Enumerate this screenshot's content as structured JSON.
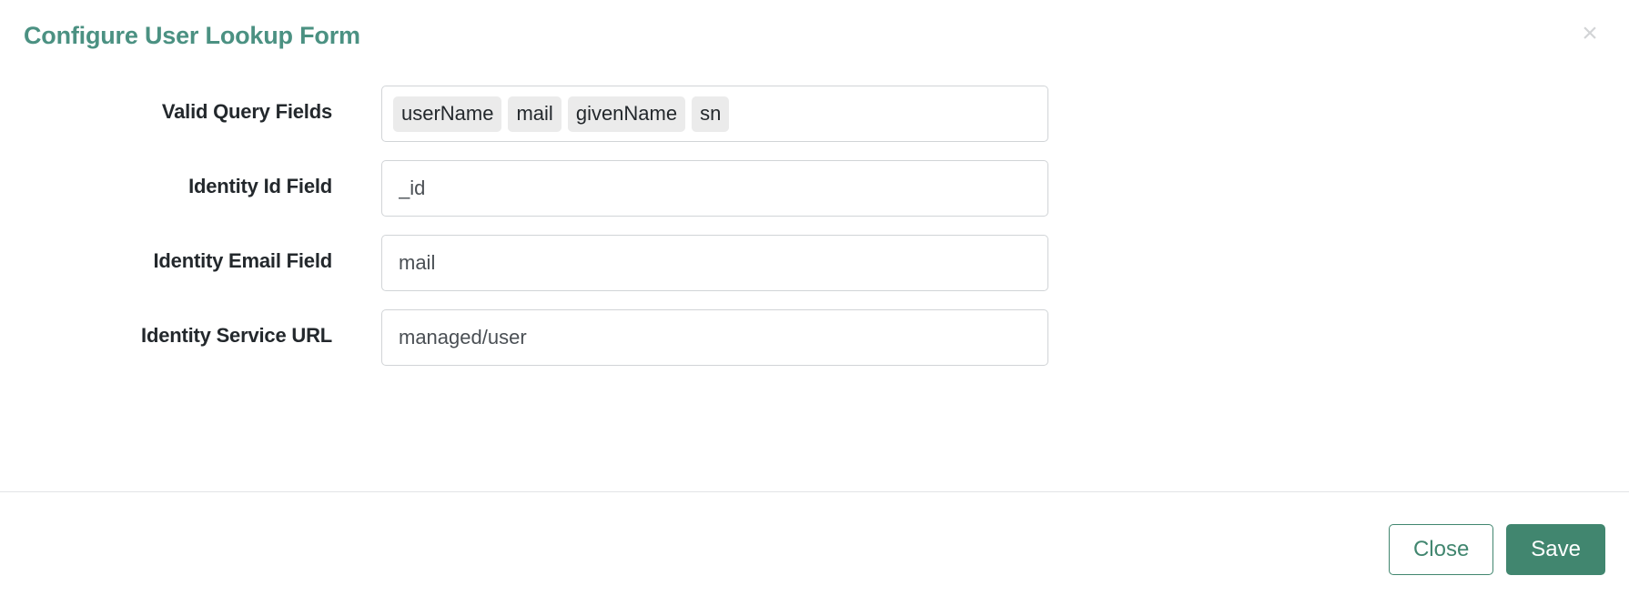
{
  "dialog": {
    "title": "Configure User Lookup Form",
    "close_icon_label": "×"
  },
  "form": {
    "fields": [
      {
        "label": "Valid Query Fields",
        "type": "tags",
        "tags": [
          "userName",
          "mail",
          "givenName",
          "sn"
        ]
      },
      {
        "label": "Identity Id Field",
        "type": "text",
        "value": "_id"
      },
      {
        "label": "Identity Email Field",
        "type": "text",
        "value": "mail"
      },
      {
        "label": "Identity Service URL",
        "type": "text",
        "value": "managed/user"
      }
    ]
  },
  "footer": {
    "close_label": "Close",
    "save_label": "Save"
  },
  "colors": {
    "title": "#4b9182",
    "primary": "#41866f",
    "chip_bg": "#ebebeb",
    "border": "#d1d4d7",
    "text": "#23282c"
  }
}
